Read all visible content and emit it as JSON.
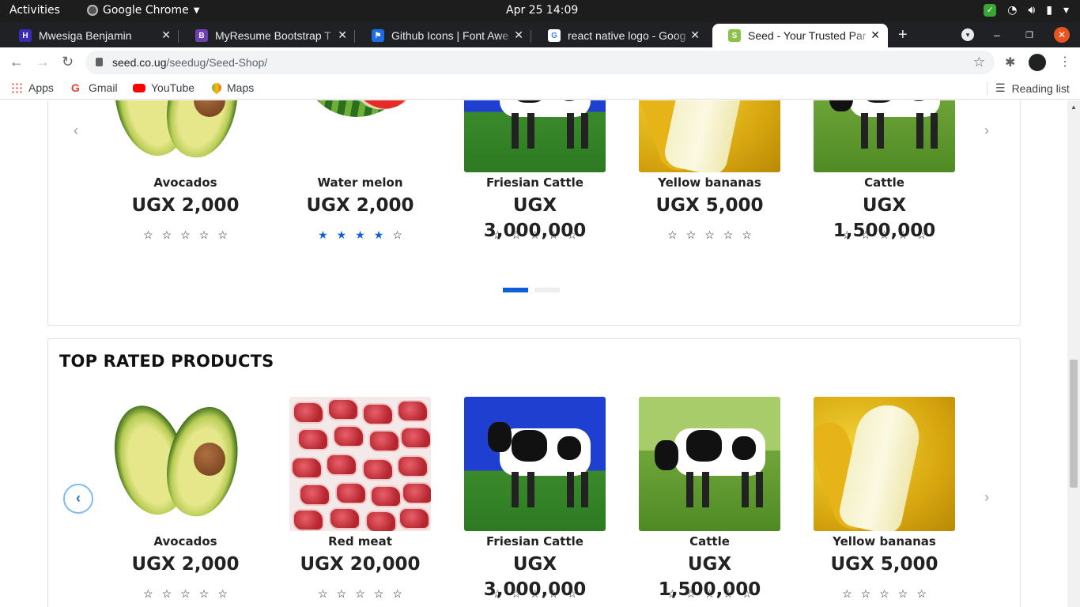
{
  "system": {
    "activities": "Activities",
    "app_name": "Google Chrome",
    "clock": "Apr 25  14:09"
  },
  "tabs": [
    {
      "title": "Mwesiga Benjamin",
      "favicon_color": "#3b2bb3",
      "favicon_letter": "H"
    },
    {
      "title": "MyResume Bootstrap T",
      "favicon_color": "#6f3fb3",
      "favicon_letter": "B"
    },
    {
      "title": "Github Icons | Font Awe",
      "favicon_color": "#1c6ee8",
      "favicon_letter": "⚑"
    },
    {
      "title": "react native logo - Goog",
      "favicon_color": "#ffffff",
      "favicon_letter": "G"
    },
    {
      "title": "Seed - Your Trusted Par",
      "favicon_color": "#8bc34a",
      "favicon_letter": "S",
      "active": true
    }
  ],
  "address_bar": {
    "domain": "seed.co.ug",
    "path": "/seedug/Seed-Shop/"
  },
  "bookmarks": {
    "apps": "Apps",
    "gmail": "Gmail",
    "youtube": "YouTube",
    "maps": "Maps",
    "reading_list": "Reading list"
  },
  "section1": {
    "products": [
      {
        "name": "Avocados",
        "price": "UGX 2,000",
        "image": "avocado",
        "rating": 0
      },
      {
        "name": "Water melon",
        "price": "UGX 2,000",
        "image": "watermelon",
        "rating": 4
      },
      {
        "name": "Friesian Cattle",
        "price": "UGX 3,000,000",
        "image": "cow-blue-sky",
        "rating": 0
      },
      {
        "name": "Yellow bananas",
        "price": "UGX 5,000",
        "image": "banana",
        "rating": 0
      },
      {
        "name": "Cattle",
        "price": "UGX 1,500,000",
        "image": "cow-green",
        "rating": 0
      }
    ],
    "active_page": 1,
    "page_count": 2
  },
  "section2": {
    "title": "TOP RATED PRODUCTS",
    "products": [
      {
        "name": "Avocados",
        "price": "UGX 2,000",
        "image": "avocado",
        "rating": 0
      },
      {
        "name": "Red meat",
        "price": "UGX 20,000",
        "image": "red-meat",
        "rating": 0
      },
      {
        "name": "Friesian Cattle",
        "price": "UGX 3,000,000",
        "image": "cow-blue-sky",
        "rating": 0
      },
      {
        "name": "Cattle",
        "price": "UGX 1,500,000",
        "image": "cow-green",
        "rating": 0
      },
      {
        "name": "Yellow bananas",
        "price": "UGX 5,000",
        "image": "banana",
        "rating": 0
      }
    ]
  },
  "colors": {
    "accent": "#0d60d8",
    "chrome_dark": "#202124",
    "close_button": "#e95420"
  }
}
